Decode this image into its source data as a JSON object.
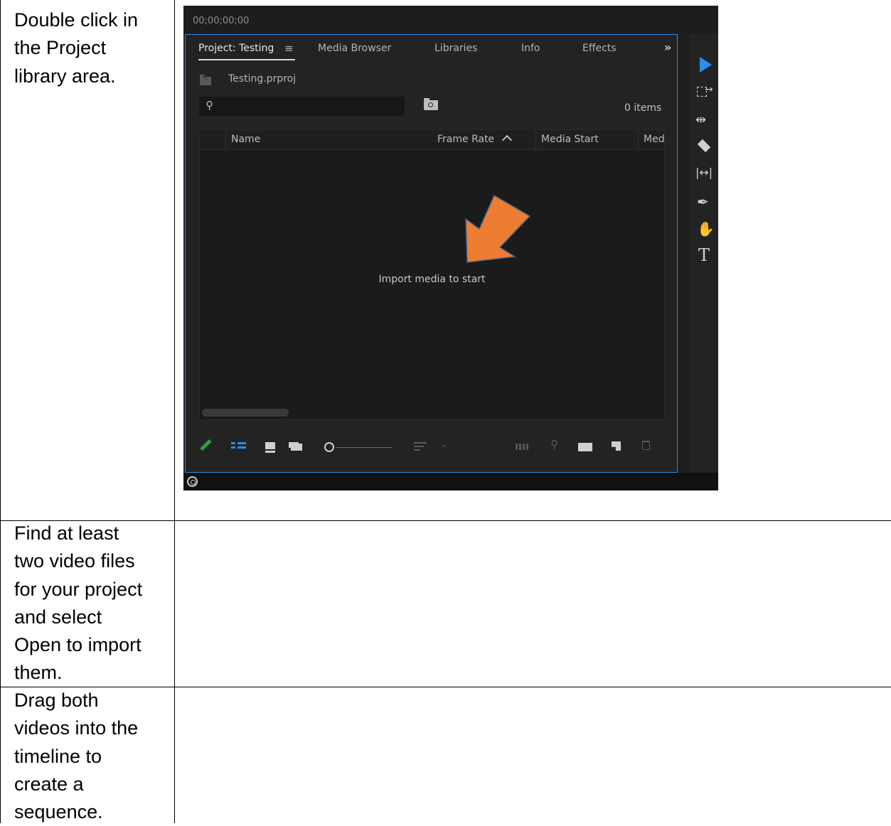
{
  "steps": [
    {
      "instruction_lines": [
        "Double click in",
        "the Project",
        "library area."
      ]
    },
    {
      "instruction_lines": [
        "Find at least",
        "two video files",
        "for your project",
        "and select",
        "Open to import",
        "them."
      ]
    },
    {
      "instruction_lines": [
        "Drag both",
        "videos into the",
        "timeline to",
        "create a",
        "sequence."
      ]
    }
  ],
  "screenshot": {
    "timecode": "00;00;00;00",
    "tabs": [
      {
        "label": "Project: Testing",
        "active": true
      },
      {
        "label": "Media Browser",
        "active": false
      },
      {
        "label": "Libraries",
        "active": false
      },
      {
        "label": "Info",
        "active": false
      },
      {
        "label": "Effects",
        "active": false
      }
    ],
    "tab_menu_glyph": "≡",
    "tab_overflow_glyph": "»",
    "project_file": "Testing.prproj",
    "search_placeholder": "",
    "item_count": "0 items",
    "columns": [
      "Name",
      "Frame Rate",
      "Media Start",
      "Med"
    ],
    "empty_message": "Import media to start",
    "annotation_arrow_color": "#ed7d31",
    "accent_color": "#2d8ceb",
    "icons": {
      "bottom_bar": [
        "pencil-icon",
        "list-view-icon",
        "icon-view-icon",
        "freeform-icon",
        "zoom-slider",
        "sort-icon",
        "automate-icon",
        "find-icon",
        "new-bin-icon",
        "new-item-icon",
        "trash-icon"
      ],
      "tools": [
        "selection-tool-icon",
        "track-select-icon",
        "ripple-edit-icon",
        "razor-icon",
        "slip-icon",
        "pen-tool-icon",
        "hand-icon",
        "type-icon"
      ]
    }
  }
}
